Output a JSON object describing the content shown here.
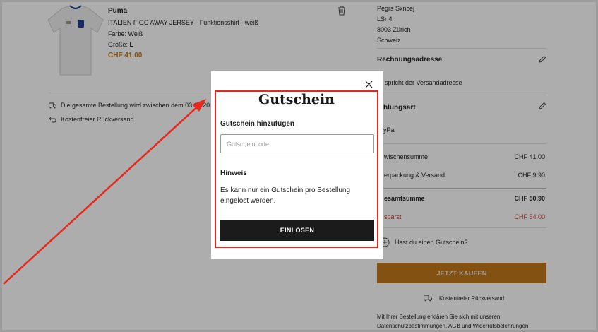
{
  "cart": {
    "brand": "Puma",
    "product_name": "ITALIEN FIGC AWAY JERSEY - Funktionsshirt - weiß",
    "color": "Farbe: Weiß",
    "size_label": "Größe: ",
    "size_value": "L",
    "price": "CHF 41.00",
    "delivery_text": "Die gesamte Bestellung wird zwischen dem 03.06.20",
    "return_text": "Kostenfreier Rückversand"
  },
  "summary": {
    "address_lines": [
      "Pegrs Sxncej",
      "LSr 4",
      "8003 Zürich",
      "Schweiz"
    ],
    "billing_title": "Rechnungsadresse",
    "billing_text": "spricht der Versandadresse",
    "payment_title": "hlungsart",
    "payment_value": "yPal",
    "subtotal_label": "wischensumme",
    "subtotal_value": "CHF 41.00",
    "shipping_label": "erpackung & Versand",
    "shipping_value": "CHF 9.90",
    "total_label": "esamtsumme",
    "total_value": "CHF 50.90",
    "savings_label": "sparst",
    "savings_value": "CHF 54.00",
    "voucher_link": "Hast du einen Gutschein?",
    "buy_button": "JETZT KAUFEN",
    "free_return": "Kostenfreier Rückversand",
    "legal_line1": "Mit Ihrer Bestellung erklären Sie sich mit unseren",
    "legal_line2": "Datenschutzbestimmungen, AGB und Widerrufsbelehrungen"
  },
  "modal": {
    "title": "Gutschein",
    "subtitle": "Gutschein hinzufügen",
    "input_placeholder": "Gutscheincode",
    "input_value": "",
    "hint_title": "Hinweis",
    "hint_text": "Es kann nur ein Gutschein pro Bestellung eingelöst werden.",
    "redeem_button": "EINLÖSEN"
  },
  "colors": {
    "accent": "#c27a1b",
    "savings": "#c0392b",
    "highlight": "#e8281c",
    "button_dark": "#1b1b1b"
  },
  "icons": [
    "trash-icon",
    "truck-icon",
    "return-icon",
    "pencil-icon",
    "plus-circle-icon",
    "close-icon",
    "arrow-annotation"
  ]
}
